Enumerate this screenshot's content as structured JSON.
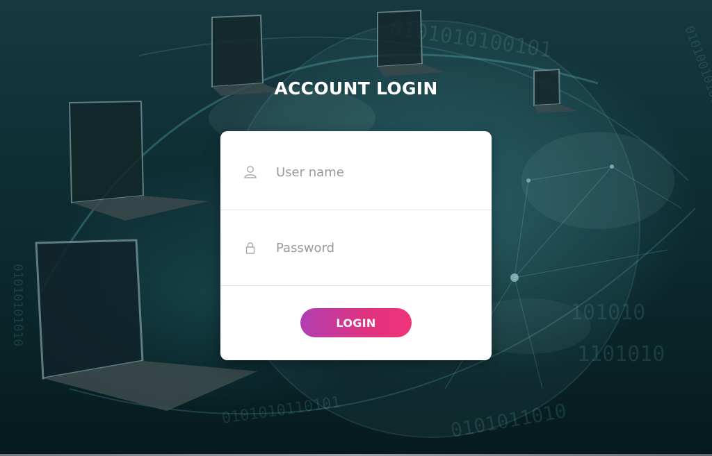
{
  "page": {
    "title": "ACCOUNT LOGIN"
  },
  "form": {
    "username": {
      "placeholder": "User name",
      "value": "",
      "icon": "user-icon"
    },
    "password": {
      "placeholder": "Password",
      "value": "",
      "icon": "lock-icon"
    },
    "submit_label": "LOGIN"
  },
  "colors": {
    "background": "#0f2f35",
    "card": "#ffffff",
    "button_gradient_start": "#b13fb2",
    "button_gradient_end": "#f0337a",
    "placeholder": "#9a9a9a"
  }
}
